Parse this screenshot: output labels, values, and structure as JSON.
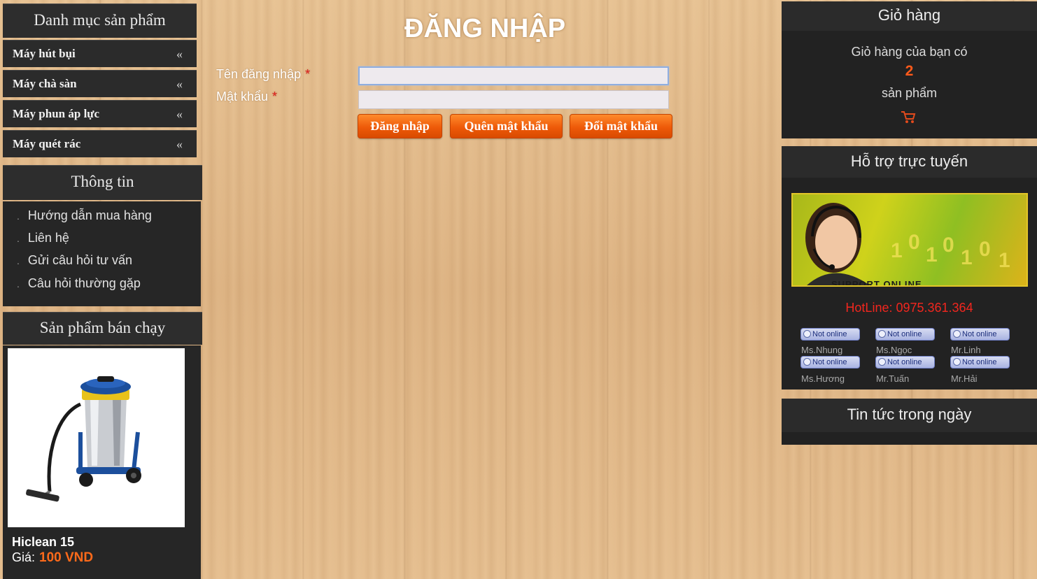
{
  "left": {
    "category_title": "Danh mục sản phẩm",
    "categories": [
      {
        "label": "Máy hút bụi",
        "chevron": "«"
      },
      {
        "label": "Máy chà sàn",
        "chevron": "«"
      },
      {
        "label": "Máy phun áp lực",
        "chevron": "«"
      },
      {
        "label": "Máy quét rác",
        "chevron": "«"
      }
    ],
    "info_title": "Thông tin",
    "info_links": [
      "Hướng dẫn mua hàng",
      "Liên hệ",
      "Gửi câu hỏi tư vấn",
      "Câu hỏi thường gặp"
    ],
    "bestseller_title": "Sản phẩm bán chạy",
    "product": {
      "name": "Hiclean 15",
      "price_label": "Giá:",
      "price": "100 VND"
    }
  },
  "login": {
    "title": "ĐĂNG NHẬP",
    "username_label": "Tên đăng nhập",
    "password_label": "Mật khẩu",
    "required_mark": "*",
    "username_value": "",
    "password_value": "",
    "buttons": {
      "login": "Đăng nhập",
      "forgot": "Quên mật khẩu",
      "change": "Đổi mật khẩu"
    }
  },
  "right": {
    "cart_title": "Giỏ hàng",
    "cart_text_before": "Giỏ hàng của bạn có",
    "cart_count": "2",
    "cart_text_after": "sản phẩm",
    "cart_icon": "cart-icon",
    "support_title": "Hỗ trợ trực tuyến",
    "banner_text": "SUPPORT ONLINE",
    "hotline": "HotLine: 0975.361.364",
    "status_label": "Not online",
    "agents": [
      "Ms.Nhung",
      "Ms.Ngọc",
      "Mr.Linh",
      "Ms.Hương",
      "Mr.Tuấn",
      "Mr.Hải"
    ],
    "news_title": "Tin tức trong ngày"
  },
  "colors": {
    "panel_dark": "#2b2b2b",
    "accent_orange": "#ee5a09",
    "price_orange": "#ff6a1a",
    "hotline_red": "#f2261e",
    "wood": "#e2b98a"
  }
}
